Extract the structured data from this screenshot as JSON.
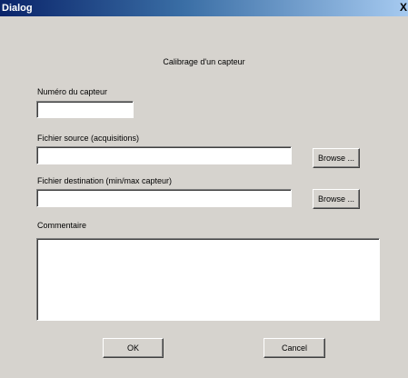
{
  "window": {
    "title": "Dialog",
    "close_glyph": "X"
  },
  "heading": "Calibrage d'un capteur",
  "sensor_number": {
    "label": "Numéro du capteur",
    "value": ""
  },
  "source_file": {
    "label": "Fichier source (acquisitions)",
    "value": "",
    "browse_label": "Browse ..."
  },
  "destination_file": {
    "label": "Fichier destination (min/max capteur)",
    "value": "",
    "browse_label": "Browse ..."
  },
  "comment": {
    "label": "Commentaire",
    "value": ""
  },
  "buttons": {
    "ok_label": "OK",
    "cancel_label": "Cancel"
  },
  "colors": {
    "dialog_background": "#d6d3ce",
    "titlebar_start": "#0a246a",
    "titlebar_end": "#a6caf0",
    "field_background": "#ffffff"
  },
  "icons": {
    "close": "close-icon"
  }
}
